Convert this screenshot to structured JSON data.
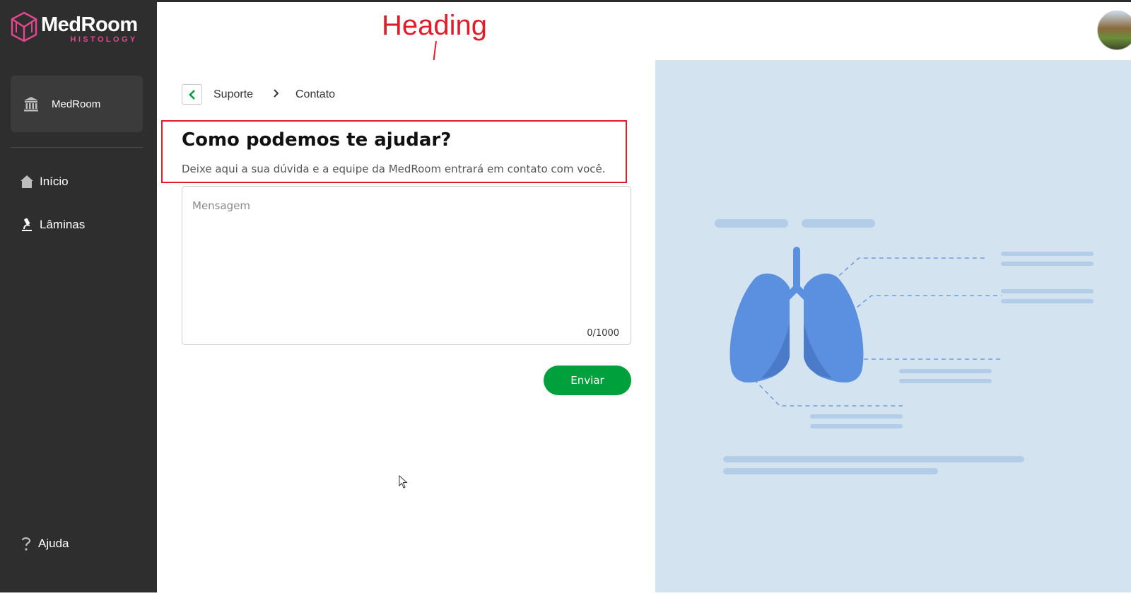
{
  "app": {
    "brand_name": "MedRoom",
    "brand_sub": "HISTOLOGY",
    "brand_color": "#e0488f"
  },
  "sidebar": {
    "org_label": "MedRoom",
    "org_icon": "bank-icon",
    "items": [
      {
        "label": "Início",
        "icon": "home-icon"
      },
      {
        "label": "Lâminas",
        "icon": "microscope-icon"
      }
    ],
    "help_label": "Ajuda",
    "help_icon": "question-icon"
  },
  "annotation": {
    "label": "Heading",
    "color": "#e11d2a"
  },
  "breadcrumb": {
    "items": [
      "Suporte",
      "Contato"
    ]
  },
  "contact": {
    "title": "Como podemos te ajudar?",
    "subtitle": "Deixe aqui a sua dúvida e a equipe da MedRoom entrará em contato com você.",
    "message_placeholder": "Mensagem",
    "counter": "0/1000",
    "send_label": "Enviar",
    "send_color": "#00a03c"
  },
  "illustration": {
    "subject": "lungs-illustration",
    "panel_color": "#d4e3f0",
    "accent_color": "#5b8fdf"
  }
}
